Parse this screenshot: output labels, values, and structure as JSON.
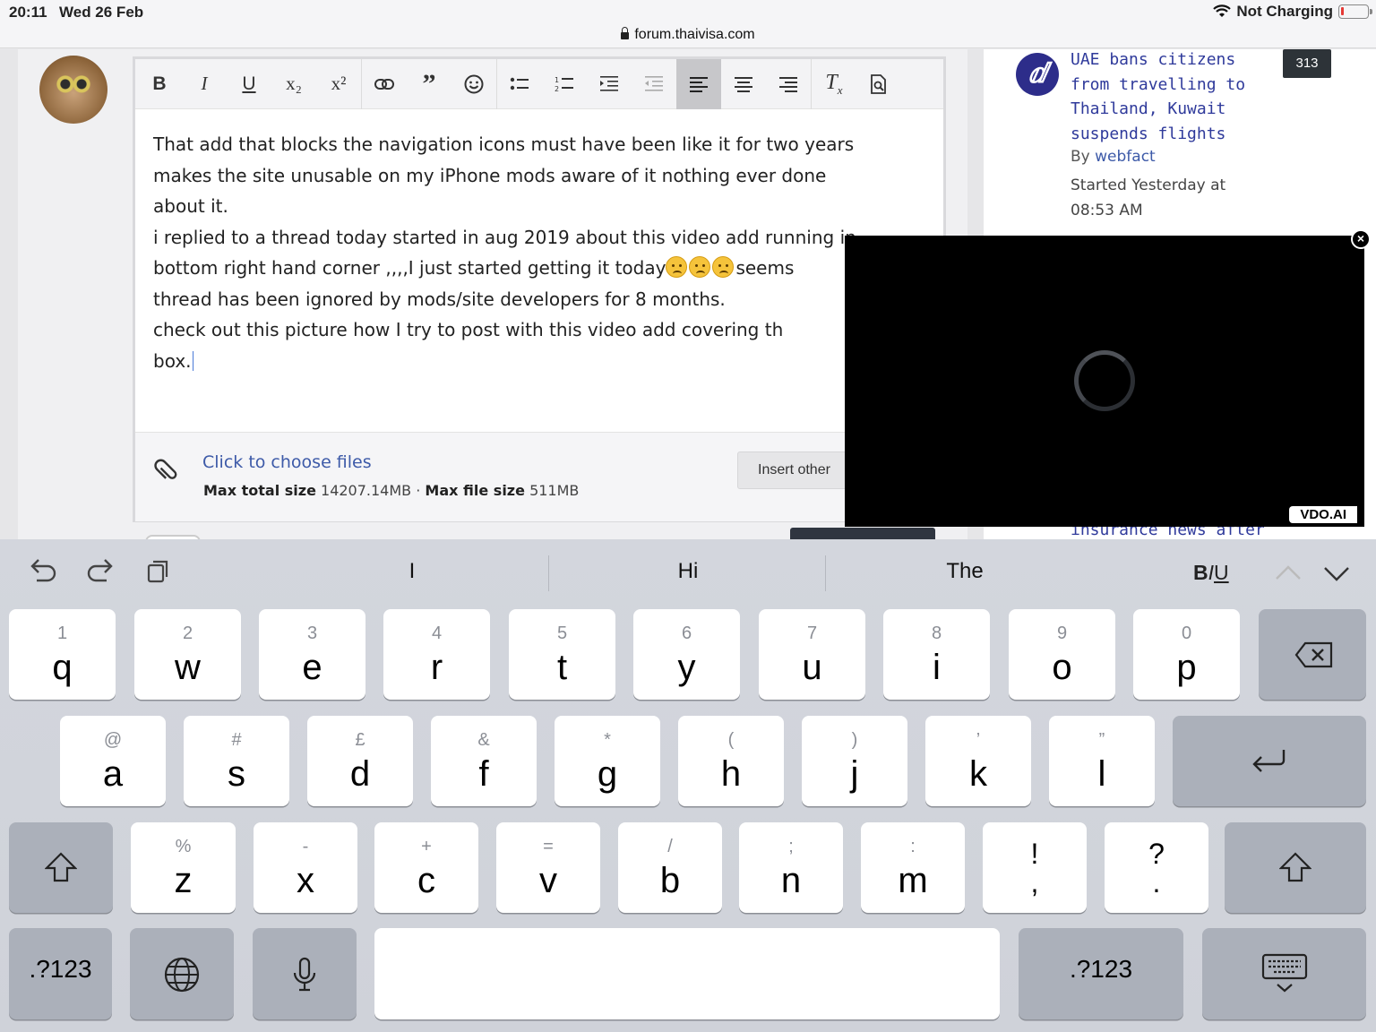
{
  "status_bar": {
    "time": "20:11",
    "date": "Wed 26 Feb",
    "network": "Not Charging"
  },
  "browser": {
    "url": "forum.thaivisa.com"
  },
  "editor": {
    "toolbar": [
      "B",
      "I",
      "U",
      "x₂",
      "x²",
      "link",
      "quote",
      "emoji",
      "bulleted-list",
      "numbered-list",
      "indent",
      "outdent",
      "align-left",
      "align-center",
      "align-right",
      "clear-format",
      "preview"
    ],
    "lines": [
      "That add that blocks the navigation icons must have been like it for two years",
      "makes the site unusable on my iPhone mods aware of it nothing ever done",
      "about it.",
      "i replied to a thread today started in aug 2019 about this video add running in",
      "bottom right hand corner ,,,,I just started getting it today",
      "seems",
      "thread has been ignored by mods/site developers for 8 months.",
      "check out this picture how I try to post with this video add covering th",
      "box."
    ],
    "attach": {
      "choose_label": "Click to choose files",
      "max_total_label": "Max total size",
      "max_total_value": "14207.14MB",
      "separator": "·",
      "max_file_label": "Max file size",
      "max_file_value": "511MB",
      "insert_label": "Insert other"
    }
  },
  "sidebar": {
    "thread": {
      "logo": "ⅆ",
      "title": "UAE bans citizens from travelling to Thailand, Kuwait suspends flights",
      "count": "313",
      "by_label": "By",
      "author": "webfact",
      "started": "Started Yesterday at 08:53 AM"
    },
    "next_thread_fragment": "insurance news after"
  },
  "ad": {
    "badge": "VDO.AI",
    "close": "×"
  },
  "keyboard": {
    "suggestions": [
      "I",
      "Hi",
      "The"
    ],
    "format": {
      "b": "B",
      "i": "I",
      "u": "U"
    },
    "row1": [
      {
        "sub": "1",
        "main": "q"
      },
      {
        "sub": "2",
        "main": "w"
      },
      {
        "sub": "3",
        "main": "e"
      },
      {
        "sub": "4",
        "main": "r"
      },
      {
        "sub": "5",
        "main": "t"
      },
      {
        "sub": "6",
        "main": "y"
      },
      {
        "sub": "7",
        "main": "u"
      },
      {
        "sub": "8",
        "main": "i"
      },
      {
        "sub": "9",
        "main": "o"
      },
      {
        "sub": "0",
        "main": "p"
      }
    ],
    "row2": [
      {
        "sub": "@",
        "main": "a"
      },
      {
        "sub": "#",
        "main": "s"
      },
      {
        "sub": "£",
        "main": "d"
      },
      {
        "sub": "&",
        "main": "f"
      },
      {
        "sub": "*",
        "main": "g"
      },
      {
        "sub": "(",
        "main": "h"
      },
      {
        "sub": ")",
        "main": "j"
      },
      {
        "sub": "’",
        "main": "k"
      },
      {
        "sub": "”",
        "main": "l"
      }
    ],
    "row3": [
      {
        "sub": "%",
        "main": "z"
      },
      {
        "sub": "-",
        "main": "x"
      },
      {
        "sub": "+",
        "main": "c"
      },
      {
        "sub": "=",
        "main": "v"
      },
      {
        "sub": "/",
        "main": "b"
      },
      {
        "sub": ";",
        "main": "n"
      },
      {
        "sub": ":",
        "main": "m"
      },
      {
        "sub": "!",
        "main": ","
      },
      {
        "sub": "?",
        "main": "."
      }
    ],
    "numbers_label": ".?123"
  }
}
